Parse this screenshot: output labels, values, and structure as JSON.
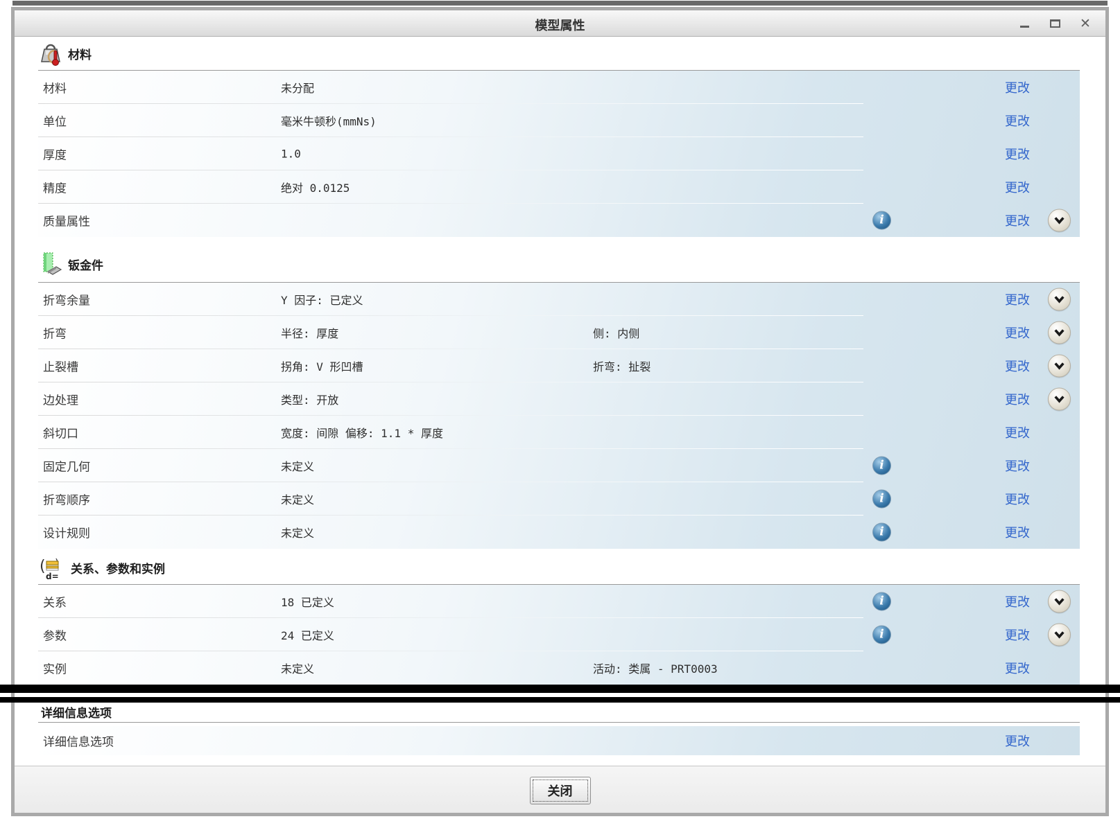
{
  "dialog": {
    "title": "模型属性",
    "close_button": "关闭"
  },
  "icons": {
    "info": "i",
    "close": "✕"
  },
  "sections": [
    {
      "title": "材料",
      "icon": "material-weight-icon",
      "rows": [
        {
          "label": "材料",
          "value": "未分配",
          "change": "更改"
        },
        {
          "label": "单位",
          "value": "毫米牛顿秒(mmNs)",
          "change": "更改"
        },
        {
          "label": "厚度",
          "value": "1.0",
          "change": "更改"
        },
        {
          "label": "精度",
          "value": "绝对 0.0125",
          "change": "更改"
        },
        {
          "label": "质量属性",
          "value": "",
          "info": true,
          "change": "更改",
          "expandable": true
        }
      ]
    },
    {
      "title": "钣金件",
      "icon": "sheet-metal-icon",
      "rows": [
        {
          "label": "折弯余量",
          "value": "Y 因子: 已定义",
          "change": "更改",
          "expandable": true
        },
        {
          "label": "折弯",
          "value": "半径: 厚度",
          "value2": "侧: 内侧",
          "change": "更改",
          "expandable": true
        },
        {
          "label": "止裂槽",
          "value": "拐角: V 形凹槽",
          "value2": "折弯: 扯裂",
          "change": "更改",
          "expandable": true
        },
        {
          "label": "边处理",
          "value": "类型: 开放",
          "change": "更改",
          "expandable": true
        },
        {
          "label": "斜切口",
          "value": "宽度: 间隙 偏移: 1.1 * 厚度",
          "change": "更改"
        },
        {
          "label": "固定几何",
          "value": "未定义",
          "info": true,
          "change": "更改"
        },
        {
          "label": "折弯顺序",
          "value": "未定义",
          "info": true,
          "change": "更改"
        },
        {
          "label": "设计规则",
          "value": "未定义",
          "info": true,
          "change": "更改"
        }
      ]
    },
    {
      "title": "关系、参数和实例",
      "icon": "relations-parameters-icon",
      "rows": [
        {
          "label": "关系",
          "value": "18 已定义",
          "info": true,
          "change": "更改",
          "expandable": true
        },
        {
          "label": "参数",
          "value": "24 已定义",
          "info": true,
          "change": "更改",
          "expandable": true
        },
        {
          "label": "实例",
          "value": "未定义",
          "value2": "活动: 类属 - PRT0003",
          "change": "更改"
        }
      ]
    },
    {
      "title": "详细信息选项",
      "icon": null,
      "rows": [
        {
          "label": "详细信息选项",
          "value": "",
          "change": "更改"
        }
      ]
    }
  ],
  "colors": {
    "link_blue": "#3366cc",
    "row_blue": "#cfe0ea",
    "border_gray": "#a9a9a9"
  }
}
